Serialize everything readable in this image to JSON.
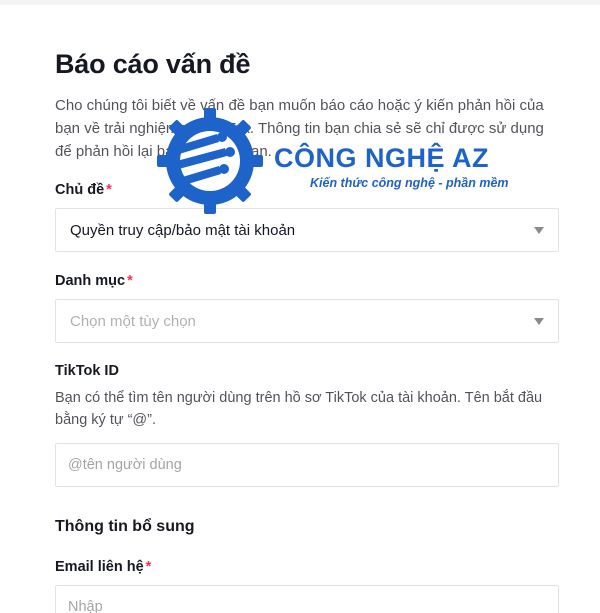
{
  "form": {
    "title": "Báo cáo vấn đề",
    "intro": "Cho chúng tôi biết về vấn đề bạn muốn báo cáo hoặc ý kiến phản hồi của bạn về trải nghiệm với TikTok. Thông tin bạn chia sẻ sẽ chỉ được sử dụng để phản hồi lại báo cáo của bạn.",
    "topic": {
      "label": "Chủ đề",
      "required_mark": "*",
      "selected_value": "Quyền truy cập/bảo mật tài khoản"
    },
    "category": {
      "label": "Danh mục",
      "required_mark": "*",
      "placeholder": "Chọn một tùy chọn"
    },
    "tiktok_id": {
      "label": "TikTok ID",
      "hint": "Bạn có thể tìm tên người dùng trên hồ sơ TikTok của tài khoản. Tên bắt đầu bằng ký tự “@”.",
      "placeholder": "@tên người dùng"
    },
    "additional_info": {
      "heading": "Thông tin bổ sung"
    },
    "email": {
      "label": "Email liên hệ",
      "required_mark": "*",
      "placeholder": "Nhập"
    }
  },
  "watermark": {
    "brand": "CÔNG NGHỆ AZ",
    "slogan": "Kiến thức công nghệ - phần mềm",
    "color": "#1e63c9"
  },
  "colors": {
    "required": "#fe2c55",
    "text": "#161823",
    "border": "#e3e3e4"
  }
}
